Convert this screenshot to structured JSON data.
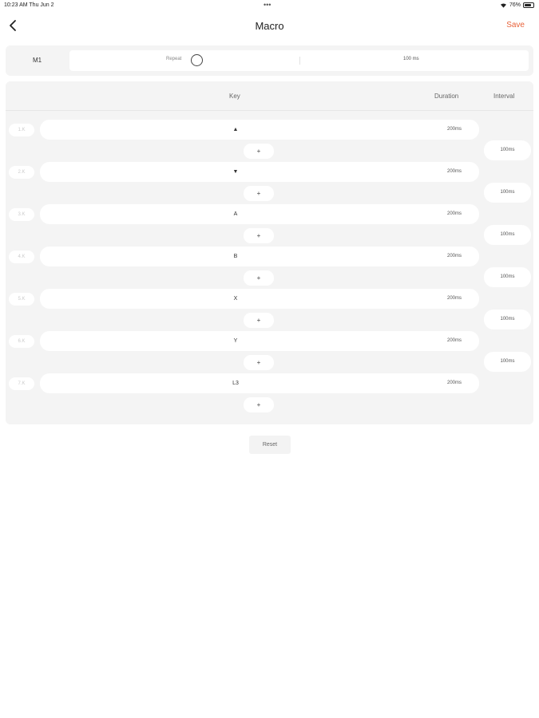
{
  "status_bar": {
    "time": "10:23 AM   Thu Jun 2",
    "dots": "•••",
    "battery_text": "76%",
    "battery_level": 0.76
  },
  "nav": {
    "title": "Macro",
    "save_label": "Save",
    "accent_color": "#e8623a"
  },
  "macro_bar": {
    "slot": "M1",
    "repeat_label": "Repeat",
    "interval_value": "100 ms"
  },
  "table": {
    "headers": {
      "key": "Key",
      "duration": "Duration",
      "interval": "Interval"
    },
    "rows": [
      {
        "num": "1.K",
        "key": "▲",
        "duration": "200ms",
        "interval": "100ms"
      },
      {
        "num": "2.K",
        "key": "▼",
        "duration": "200ms",
        "interval": "100ms"
      },
      {
        "num": "3.K",
        "key": "A",
        "duration": "200ms",
        "interval": "100ms"
      },
      {
        "num": "4.K",
        "key": "B",
        "duration": "200ms",
        "interval": "100ms"
      },
      {
        "num": "5.K",
        "key": "X",
        "duration": "200ms",
        "interval": "100ms"
      },
      {
        "num": "6.K",
        "key": "Y",
        "duration": "200ms",
        "interval": "100ms"
      },
      {
        "num": "7.K",
        "key": "L3",
        "duration": "200ms"
      }
    ],
    "add_label": "+"
  },
  "reset_label": "Reset"
}
